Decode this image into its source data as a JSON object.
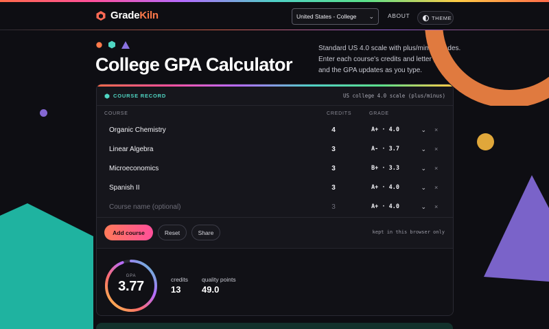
{
  "brand": {
    "name_part1": "Grade",
    "name_part2": "Kiln"
  },
  "header": {
    "region_selected": "United States - College",
    "about_label": "ABOUT",
    "theme_label": "THEME"
  },
  "hero": {
    "title": "College GPA Calculator",
    "intro": "Standard US 4.0 scale with plus/minus grades. Enter each course's credits and letter grade, and the GPA updates as you type."
  },
  "card": {
    "title": "COURSE RECORD",
    "scale_note": "US college 4.0 scale (plus/minus)",
    "columns": {
      "course": "COURSE",
      "credits": "CREDITS",
      "grade": "GRADE"
    },
    "rows": [
      {
        "course": "Organic Chemistry",
        "credits": "4",
        "grade": "A+ · 4.0",
        "remove": "×"
      },
      {
        "course": "Linear Algebra",
        "credits": "3",
        "grade": "A- · 3.7",
        "remove": "×"
      },
      {
        "course": "Microeconomics",
        "credits": "3",
        "grade": "B+ · 3.3",
        "remove": "×"
      },
      {
        "course": "Spanish II",
        "credits": "3",
        "grade": "A+ · 4.0",
        "remove": "×"
      }
    ],
    "new_row": {
      "course_placeholder": "Course name (optional)",
      "credits_placeholder": "3",
      "grade": "A+ · 4.0",
      "remove": "×"
    },
    "actions": {
      "add": "Add course",
      "reset": "Reset",
      "share": "Share",
      "storage_note": "kept in this browser only"
    }
  },
  "summary": {
    "gpa_label": "GPA",
    "gpa_value": "3.77",
    "gpa_fraction": 0.9425,
    "credits_label": "credits",
    "credits_value": "13",
    "quality_label": "quality points",
    "quality_value": "49.0"
  },
  "colors": {
    "accent_orange": "#ff7a4a",
    "accent_pink": "#ff4f9a",
    "accent_teal": "#4fd6c3",
    "accent_purple": "#8467d3",
    "accent_yellow": "#e0a73a",
    "background": "#0e0e13"
  }
}
